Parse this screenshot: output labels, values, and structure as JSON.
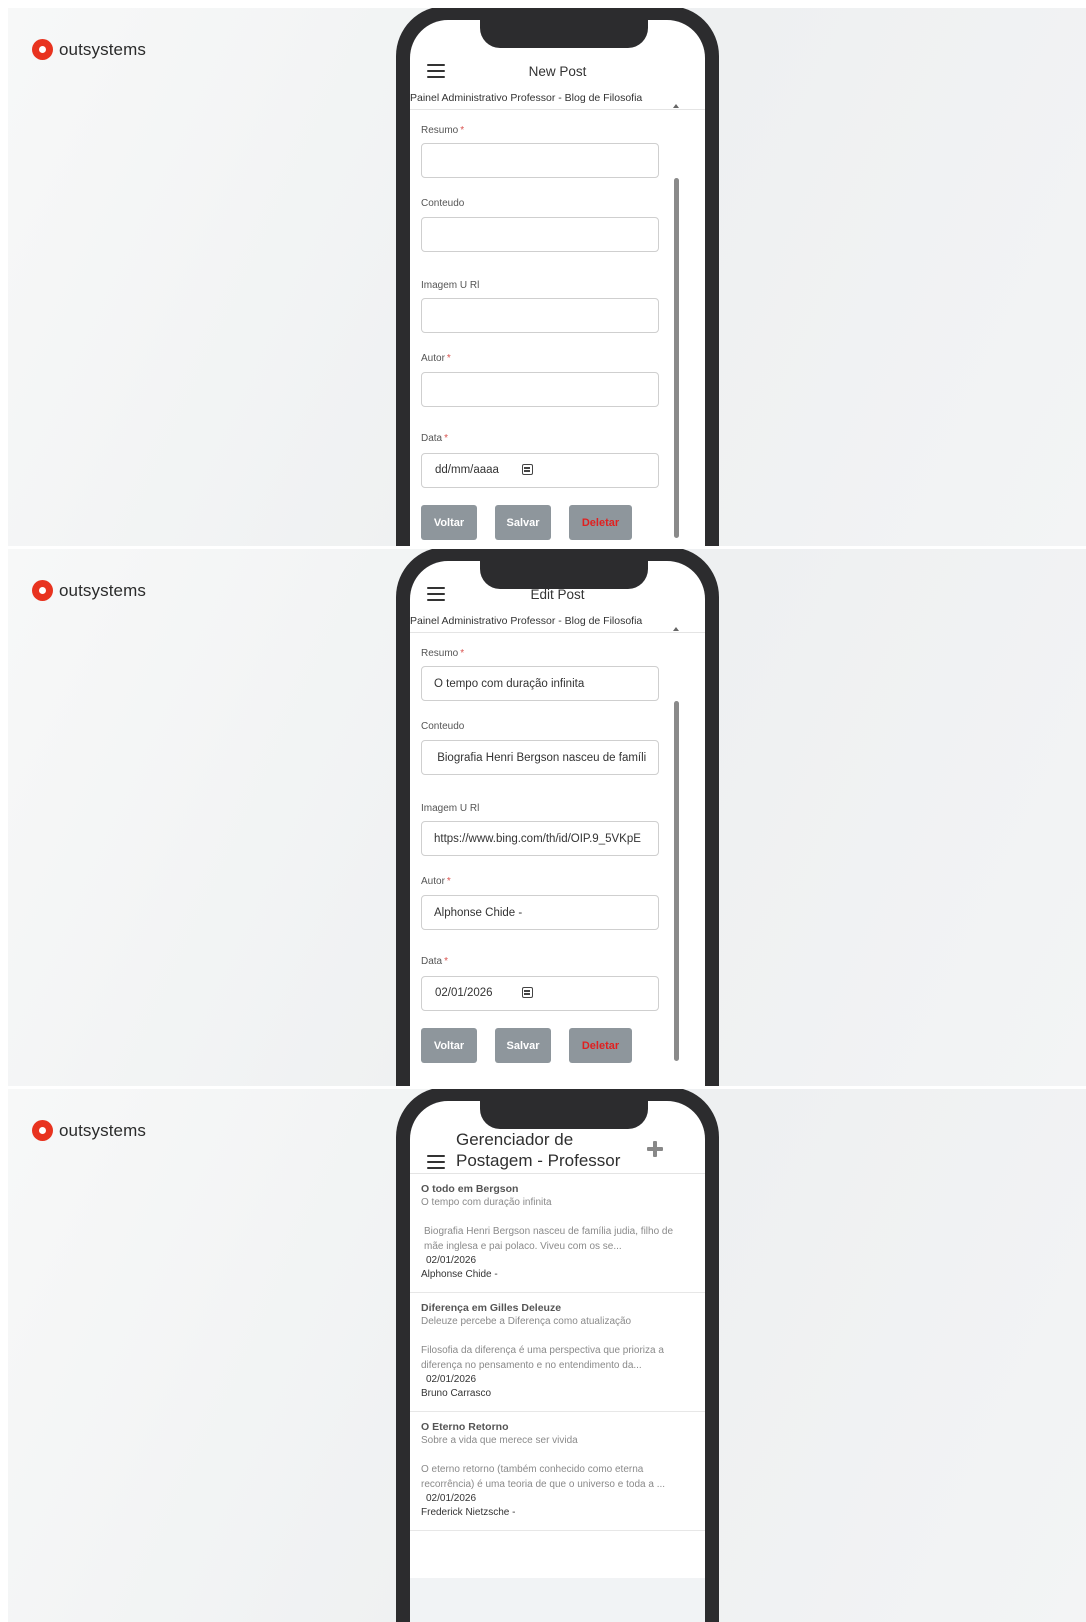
{
  "brand": {
    "name": "outsystems"
  },
  "colors": {
    "brand_red": "#e8331f",
    "button_gray": "#8e969c",
    "delete_red": "#e02020",
    "required": "#d9534f"
  },
  "form_labels": {
    "resumo": "Resumo",
    "conteudo": "Conteudo",
    "imagem_url": "Imagem U Rl",
    "autor": "Autor",
    "data": "Data",
    "required_mark": "*"
  },
  "buttons": {
    "voltar": "Voltar",
    "salvar": "Salvar",
    "deletar": "Deletar"
  },
  "subtitle": "Painel Administrativo Professor - Blog de Filosofia",
  "new_post": {
    "title": "New Post",
    "values": {
      "resumo": "",
      "conteudo": "",
      "imagem_url": "",
      "autor": ""
    },
    "date_placeholder": "dd/mm/aaaa"
  },
  "edit_post": {
    "title": "Edit Post",
    "values": {
      "resumo": "O tempo com duração infinita",
      "conteudo": " Biografia Henri Bergson nasceu de famíli",
      "imagem_url": "https://www.bing.com/th/id/OIP.9_5VKpE",
      "autor": "Alphonse Chide -"
    },
    "date": "02/01/2026"
  },
  "post_manager": {
    "title": "Gerenciador de Postagem - Professor",
    "posts": [
      {
        "title": "O todo em Bergson",
        "summary": "O tempo com duração infinita",
        "content": "Biografia Henri Bergson nasceu de família judia, filho de mãe inglesa e pai polaco. Viveu com os se...",
        "date": "02/01/2026",
        "author": "Alphonse Chide -"
      },
      {
        "title": "Diferença em Gilles Deleuze",
        "summary": "Deleuze percebe a Diferença como atualização",
        "content": "Filosofia da diferença é uma perspectiva que prioriza a diferença no pensamento e no entendimento da...",
        "date": "02/01/2026",
        "author": "Bruno Carrasco"
      },
      {
        "title": "O Eterno Retorno",
        "summary": "Sobre a vida que merece ser vivida",
        "content": "O eterno retorno (também conhecido como eterna recorrência) é uma teoria de que o universo e toda a ...",
        "date": "02/01/2026",
        "author": "Frederick Nietzsche -"
      }
    ]
  },
  "icons": [
    "menu-icon",
    "calendar-icon",
    "plus-icon",
    "scroll-up-arrow-icon",
    "outsystems-logo-icon"
  ]
}
